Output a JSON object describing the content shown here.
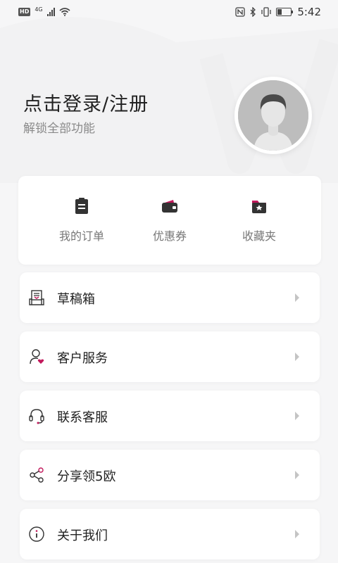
{
  "status_bar": {
    "hd": "HD",
    "network": "4G",
    "time": "5:42"
  },
  "profile": {
    "login_title": "点击登录/注册",
    "login_subtitle": "解锁全部功能"
  },
  "quick_actions": [
    {
      "label": "我的订单",
      "icon": "order-clipboard-icon"
    },
    {
      "label": "优惠券",
      "icon": "coupon-wallet-icon"
    },
    {
      "label": "收藏夹",
      "icon": "favorites-folder-icon"
    }
  ],
  "menu": [
    {
      "label": "草稿箱",
      "icon": "draft-box-icon"
    },
    {
      "label": "客户服务",
      "icon": "customer-service-icon"
    },
    {
      "label": "联系客服",
      "icon": "headset-icon"
    },
    {
      "label": "分享领5欧",
      "icon": "share-icon"
    },
    {
      "label": "关于我们",
      "icon": "info-icon"
    }
  ],
  "colors": {
    "accent": "#c2185b",
    "icon_dark": "#333333",
    "background": "#f6f6f7"
  }
}
